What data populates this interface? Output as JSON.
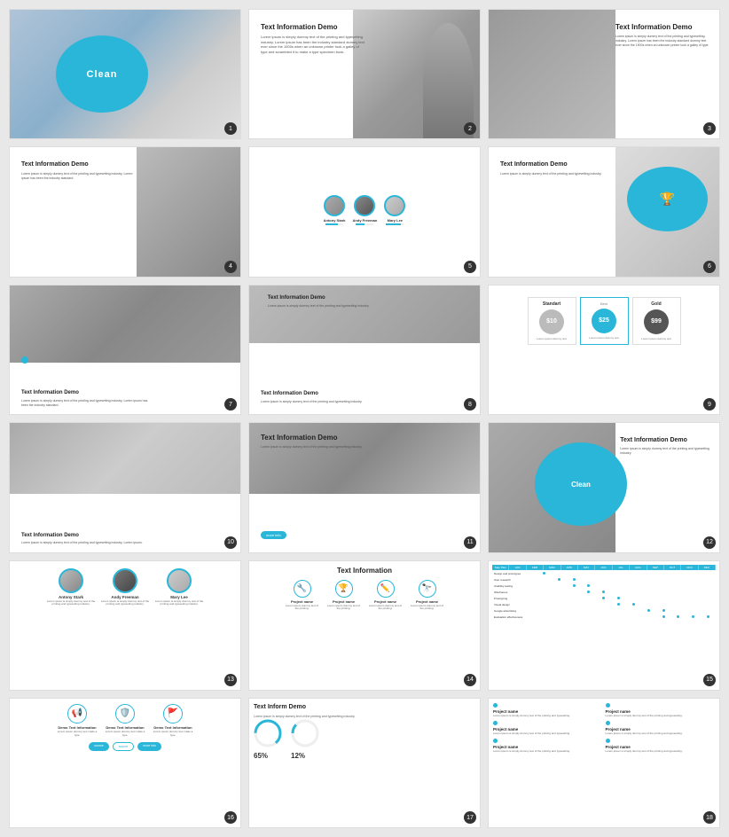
{
  "slides": [
    {
      "id": 1,
      "type": "clean-hero",
      "label": "Clean",
      "badge": "1"
    },
    {
      "id": 2,
      "type": "text-info-photo-right",
      "title": "Text Information Demo",
      "body": "Lorem ipsum is simply dummy text of the printing and typesetting industry. Lorem ipsum has been the industry standard dummy text ever since the 1500s when an unknown printer took a galley of type and scrambled it to make a type specimen book.",
      "badge": "2"
    },
    {
      "id": 3,
      "type": "text-info-photo-left",
      "title": "Text Information Demo",
      "body": "Lorem ipsum is simply dummy text of the printing and typesetting industry. Lorem ipsum has been the industry standard dummy text ever since the 1500s when an unknown printer took a galley of type.",
      "badge": "3"
    },
    {
      "id": 4,
      "type": "text-info-man",
      "title": "Text Information Demo",
      "body": "Lorem ipsum is simply dummy text of the printing and typesetting industry. Lorem ipsum has been the industry standard.",
      "badge": "4"
    },
    {
      "id": 5,
      "type": "people-portraits",
      "people": [
        {
          "name": "Antony Stark",
          "progress": 70,
          "class": "c1"
        },
        {
          "name": "Andy Freeman",
          "progress": 50,
          "class": "c2"
        },
        {
          "name": "Mary Lee",
          "progress": 85,
          "class": "c3"
        }
      ],
      "badge": "5"
    },
    {
      "id": 6,
      "type": "text-info-trophy",
      "title": "Text Information Demo",
      "body": "Lorem ipsum is simply dummy text of the printing and typesetting industry.",
      "badge": "6"
    },
    {
      "id": 7,
      "type": "mountains",
      "title": "Text Information Demo",
      "body": "Lorem ipsum is simply dummy text of the printing and typesetting industry. Lorem ipsum has been the industry standard.",
      "badge": "7"
    },
    {
      "id": 8,
      "type": "text-mountain",
      "title1": "Text Information Demo",
      "body1": "Lorem ipsum is simply dummy text of the printing and typesetting industry.",
      "title2": "Text Information Demo",
      "body2": "Lorem ipsum is simply dummy text of the printing and typesetting industry.",
      "badge": "8"
    },
    {
      "id": 9,
      "type": "pricing",
      "plans": [
        {
          "label": "Standart",
          "price": "$10",
          "class": "gray",
          "desc": "Lorem ipsum is simply dummy text of the printing.",
          "best": false
        },
        {
          "label": "Best",
          "price": "$25",
          "class": "",
          "desc": "Lorem ipsum is simply dummy text of the printing.",
          "best": true
        },
        {
          "label": "Gold",
          "price": "$99",
          "class": "dark",
          "desc": "Lorem ipsum is simply dummy text of the printing.",
          "best": false
        }
      ],
      "badge": "9"
    },
    {
      "id": 10,
      "type": "waves",
      "title": "Text Information Demo",
      "body": "Lorem ipsum is simply dummy text of the printing and typesetting industry. Lorem ipsum.",
      "badge": "10"
    },
    {
      "id": 11,
      "type": "text-info-large",
      "title": "Text Information Demo",
      "body": "Lorem ipsum is simply dummy text of the printing and typesetting industry.",
      "btn_label": "more info",
      "badge": "11"
    },
    {
      "id": 12,
      "type": "clean-circle-right",
      "circle_label": "Clean",
      "title": "Text Information Demo",
      "body": "Lorem ipsum is simply dummy text of the printing and typesetting industry.",
      "badge": "12"
    },
    {
      "id": 13,
      "type": "people-large",
      "people": [
        {
          "name": "Antony Stark",
          "desc": "Lorem ipsum is simply dummy text of the printing and typesetting industry.",
          "class": "c1"
        },
        {
          "name": "Andy Freeman",
          "desc": "Lorem ipsum is simply dummy text of the printing and typesetting industry.",
          "class": "c2"
        },
        {
          "name": "Mary Lee",
          "desc": "Lorem ipsum is simply dummy text of the printing and typesetting industry.",
          "class": "c3"
        }
      ],
      "badge": "13"
    },
    {
      "id": 14,
      "type": "text-icons",
      "title": "Text Information",
      "icons": [
        {
          "symbol": "🔧",
          "label": "Project name",
          "desc": "Lorem ipsum is simply dummy text of the printing."
        },
        {
          "symbol": "🏆",
          "label": "Project name",
          "desc": "Lorem ipsum is simply dummy text of the printing."
        },
        {
          "symbol": "✏️",
          "label": "Project name",
          "desc": "Lorem ipsum is simply dummy text of the printing."
        },
        {
          "symbol": "🔭",
          "label": "Project name",
          "desc": "Lorem ipsum is simply dummy text of the printing."
        }
      ],
      "badge": "14"
    },
    {
      "id": 15,
      "type": "schedule",
      "title": "Step Plan",
      "months": [
        "JAN",
        "FEB",
        "MAR",
        "APR",
        "MAY",
        "JUN",
        "JUL",
        "AUG",
        "SEP",
        "OCT",
        "NOV",
        "DEC"
      ],
      "rows": [
        {
          "label": "Design and prototype research tap",
          "dots": [
            1,
            0,
            0,
            0,
            0,
            0,
            0,
            0,
            0,
            0,
            0,
            0
          ]
        },
        {
          "label": "User research",
          "dots": [
            0,
            1,
            1,
            0,
            0,
            0,
            0,
            0,
            0,
            0,
            0,
            0
          ]
        },
        {
          "label": "Usability testing",
          "dots": [
            0,
            0,
            1,
            1,
            0,
            0,
            0,
            0,
            0,
            0,
            0,
            0
          ]
        },
        {
          "label": "Wireframes",
          "dots": [
            0,
            0,
            0,
            1,
            1,
            0,
            0,
            0,
            0,
            0,
            0,
            0
          ]
        },
        {
          "label": "Prototyping",
          "dots": [
            0,
            0,
            0,
            0,
            1,
            1,
            0,
            0,
            0,
            0,
            0,
            0
          ]
        },
        {
          "label": "Visual design",
          "dots": [
            0,
            0,
            0,
            0,
            0,
            1,
            1,
            0,
            0,
            0,
            0,
            0
          ]
        },
        {
          "label": "Google advertising",
          "dots": [
            0,
            0,
            0,
            0,
            0,
            0,
            0,
            1,
            1,
            0,
            0,
            0
          ]
        },
        {
          "label": "Evaluation of the effectivenes",
          "dots": [
            0,
            0,
            0,
            0,
            0,
            0,
            0,
            0,
            1,
            1,
            1,
            1
          ]
        }
      ],
      "badge": "15"
    },
    {
      "id": 16,
      "type": "demo-icons",
      "icons": [
        {
          "symbol": "📢",
          "label": "Demo Text Information",
          "desc": "Lorem ipsum is simply dummy text made a type.",
          "btn": "source",
          "btn_class": ""
        },
        {
          "symbol": "🛡️",
          "label": "Demo Text Information",
          "desc": "Lorem ipsum is simply dummy text made a type.",
          "btn": "source",
          "btn_class": "outline"
        },
        {
          "symbol": "🚩",
          "label": "Demo Text Information",
          "desc": "Lorem ipsum is simply dummy text made a type.",
          "btn": "more info",
          "btn_class": ""
        }
      ],
      "badge": "16"
    },
    {
      "id": 17,
      "type": "pie-bar",
      "title": "Text Inform Demo",
      "body": "Lorem ipsum is simply dummy text of the printing and typesetting industry.",
      "pct1": "65%",
      "pct2": "12%",
      "badge": "17"
    },
    {
      "id": 18,
      "type": "projects-grid",
      "projects": [
        {
          "name": "Project name",
          "desc": "Lorem ipsum is simply dummy text of the printing."
        },
        {
          "name": "Project name",
          "desc": "Lorem ipsum is simply dummy text of the printing."
        },
        {
          "name": "Project name",
          "desc": "Lorem ipsum is simply dummy text of the printing."
        },
        {
          "name": "Project name",
          "desc": "Lorem ipsum is simply dummy text of the printing."
        },
        {
          "name": "Project name",
          "desc": "Lorem ipsum is simply dummy text of the printing."
        },
        {
          "name": "Project name",
          "desc": "Lorem ipsum is simply dummy text of the printing."
        }
      ],
      "badge": "18"
    }
  ]
}
